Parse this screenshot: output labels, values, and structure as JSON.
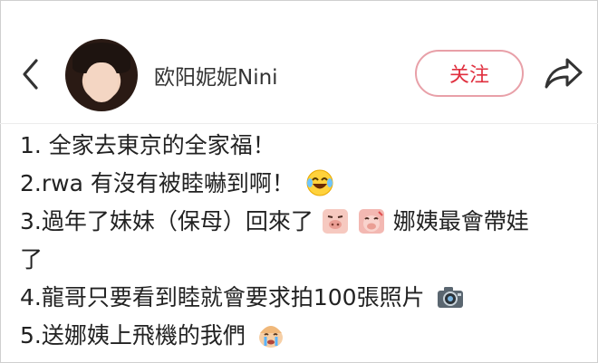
{
  "header": {
    "username": "欧阳妮妮Nini",
    "follow_label": "关注"
  },
  "post": {
    "lines": [
      {
        "text": "1. 全家去東京的全家福！"
      },
      {
        "text": "2.rwa 有沒有被睦嚇到啊！",
        "emoji": "laughing-tears-emoji"
      },
      {
        "text": "3.過年了妹妹（保母）回來了",
        "emoji_pair": [
          "piggy-sticker-emoji",
          "piggy-sticker-emoji"
        ],
        "tail": "娜姨最會帶娃"
      },
      {
        "text": "了"
      },
      {
        "text": "4.龍哥只要看到睦就會要求拍100張照片",
        "emoji": "camera-emoji"
      },
      {
        "text": "5.送娜姨上飛機的我們",
        "emoji": "crying-face-emoji"
      }
    ]
  }
}
